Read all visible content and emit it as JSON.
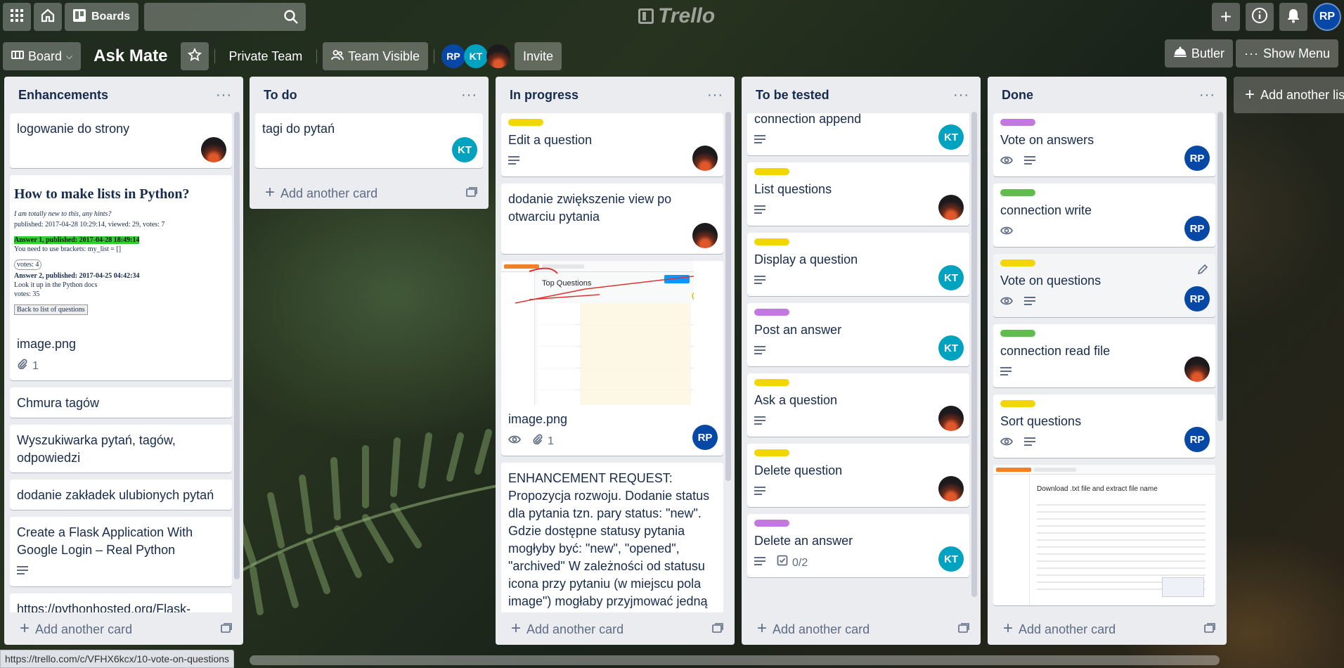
{
  "header": {
    "boards_label": "Boards",
    "logo_text": "Trello",
    "user_initials": "RP"
  },
  "board": {
    "view_label": "Board",
    "title": "Ask Mate",
    "team": "Private Team",
    "visibility": "Team Visible",
    "members": [
      "RP",
      "KT"
    ],
    "invite_label": "Invite",
    "butler_label": "Butler",
    "menu_label": "Show Menu"
  },
  "lists": [
    {
      "title": "Enhancements",
      "add_label": "Add another card",
      "cards": [
        {
          "text": "logowanie do strony",
          "avatar": "photo"
        },
        {
          "text": "image.png",
          "attachments": "1",
          "cover": "python-doc",
          "cover_title": "How to make lists in Python?",
          "cover_lines": [
            "I am totally new to this, any hints?",
            "published: 2017-04-28 10:29:14, viewed: 29, votes: 7",
            "Answer 1, published: 2017-04-28 18:49:14",
            "You need to use brackets: my_list = []",
            "votes: 4",
            "Answer 2, published: 2017-04-25 04:42:34",
            "Look it up in the Python docs",
            "votes: 35",
            "Back to list of questions"
          ]
        },
        {
          "text": "Chmura tagów"
        },
        {
          "text": "Wyszukiwarka pytań, tagów, odpowiedzi"
        },
        {
          "text": "dodanie zakładek ulubionych pytań"
        },
        {
          "text": "Create a Flask Application With Google Login – Real Python",
          "description": true
        },
        {
          "text": "https://pythonhosted.org/Flask-"
        }
      ]
    },
    {
      "title": "To do",
      "add_label": "Add another card",
      "cards": [
        {
          "text": "tagi do pytań",
          "avatar": "KT"
        }
      ]
    },
    {
      "title": "In progress",
      "add_label": "Add another card",
      "cards": [
        {
          "label": "yellow",
          "text": "Edit a question",
          "description": true,
          "avatar": "photo"
        },
        {
          "text": "dodanie zwiększenie view po otwarciu pytania",
          "avatar": "photo"
        },
        {
          "text": "image.png",
          "watch": true,
          "attachments": "1",
          "avatar": "RP",
          "cover": "so-questions",
          "cover_title": "Top Questions"
        },
        {
          "text": "ENHANCEMENT REQUEST: Propozycja rozwoju. Dodanie status dla pytania tzn. pary status: \"new\". Gdzie dostępne statusy pytania mogłyby być: \"new\", \"opened\", \"archived\" W zależności od statusu icona przy pytaniu (w miejscu pola image\") mogłaby przyjmować jedną z"
        }
      ]
    },
    {
      "title": "To be tested",
      "add_label": "Add another card",
      "cards": [
        {
          "text": "connection append",
          "description": true,
          "avatar": "KT"
        },
        {
          "label": "yellow",
          "text": "List questions",
          "description": true,
          "avatar": "photo"
        },
        {
          "label": "yellow",
          "text": "Display a question",
          "description": true,
          "avatar": "KT"
        },
        {
          "label": "purple",
          "text": "Post an answer",
          "description": true,
          "avatar": "KT"
        },
        {
          "label": "yellow",
          "text": "Ask a question",
          "description": true,
          "avatar": "photo"
        },
        {
          "label": "yellow",
          "text": "Delete question",
          "description": true,
          "avatar": "photo"
        },
        {
          "label": "purple",
          "text": "Delete an answer",
          "description": true,
          "checklist": "0/2",
          "avatar": "KT"
        }
      ]
    },
    {
      "title": "Done",
      "add_label": "Add another card",
      "cards": [
        {
          "label": "purple",
          "text": "Vote on answers",
          "watch": true,
          "description": true,
          "avatar": "RP"
        },
        {
          "label": "green",
          "text": "connection write",
          "watch": true,
          "avatar": "RP"
        },
        {
          "label": "yellow",
          "text": "Vote on questions",
          "watch": true,
          "description": true,
          "avatar": "RP",
          "hover": true
        },
        {
          "label": "green",
          "text": "connection read file",
          "description": true,
          "avatar": "photo"
        },
        {
          "label": "yellow",
          "text": "Sort questions",
          "watch": true,
          "description": true,
          "avatar": "RP"
        },
        {
          "cover": "so-download",
          "cover_title": "Download .txt file and extract file name",
          "text": ""
        }
      ]
    }
  ],
  "add_list_label": "Add another list",
  "status_url": "https://trello.com/c/VFHX6kcx/10-vote-on-questions"
}
